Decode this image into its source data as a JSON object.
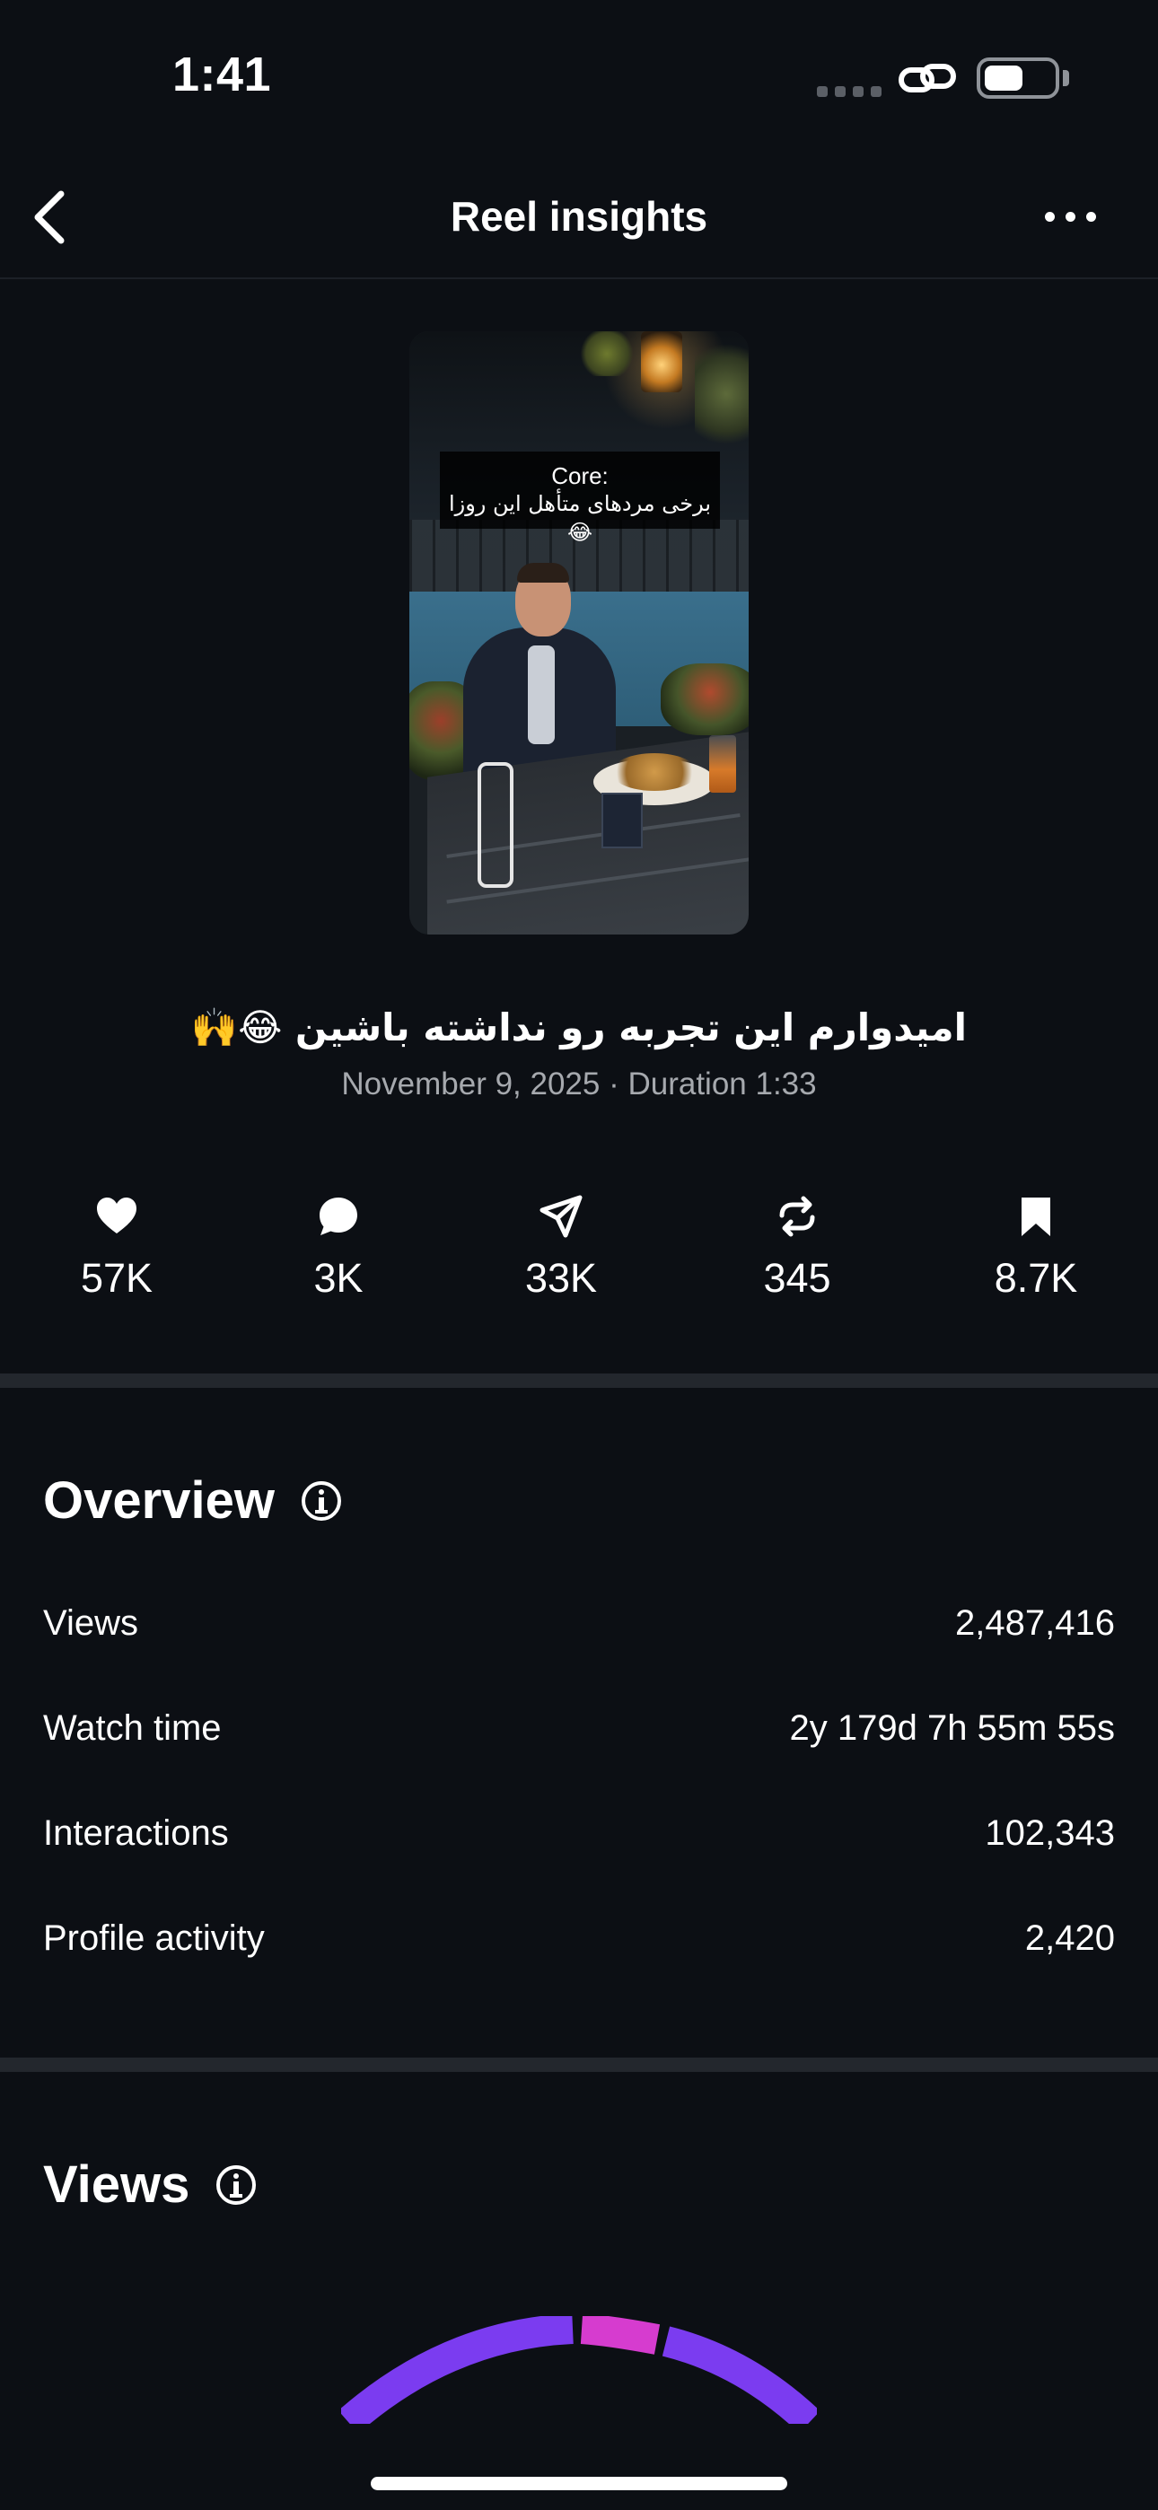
{
  "status_bar": {
    "time": "1:41"
  },
  "header": {
    "title": "Reel insights"
  },
  "reel": {
    "overlay_line1": "Core:",
    "overlay_line2": "برخی مردهای متأهل این روزا 😂"
  },
  "post": {
    "caption": "امیدوارم این تجربه رو نداشته باشین 😂🙌",
    "meta": "November 9, 2025 · Duration 1:33"
  },
  "stats": [
    {
      "icon": "heart-icon",
      "value": "57K"
    },
    {
      "icon": "comment-icon",
      "value": "3K"
    },
    {
      "icon": "send-icon",
      "value": "33K"
    },
    {
      "icon": "repost-icon",
      "value": "345"
    },
    {
      "icon": "bookmark-icon",
      "value": "8.7K"
    }
  ],
  "overview": {
    "title": "Overview",
    "rows": [
      {
        "label": "Views",
        "value": "2,487,416"
      },
      {
        "label": "Watch time",
        "value": "2y 179d 7h 55m 55s"
      },
      {
        "label": "Interactions",
        "value": "102,343"
      },
      {
        "label": "Profile activity",
        "value": "2,420"
      }
    ]
  },
  "views_section": {
    "title": "Views"
  },
  "colors": {
    "background": "#0c0f14",
    "gauge_purple": "#7b3cf0",
    "gauge_pink": "#d63ccf",
    "divider": "#23272d",
    "muted_text": "#a6a9ae"
  }
}
